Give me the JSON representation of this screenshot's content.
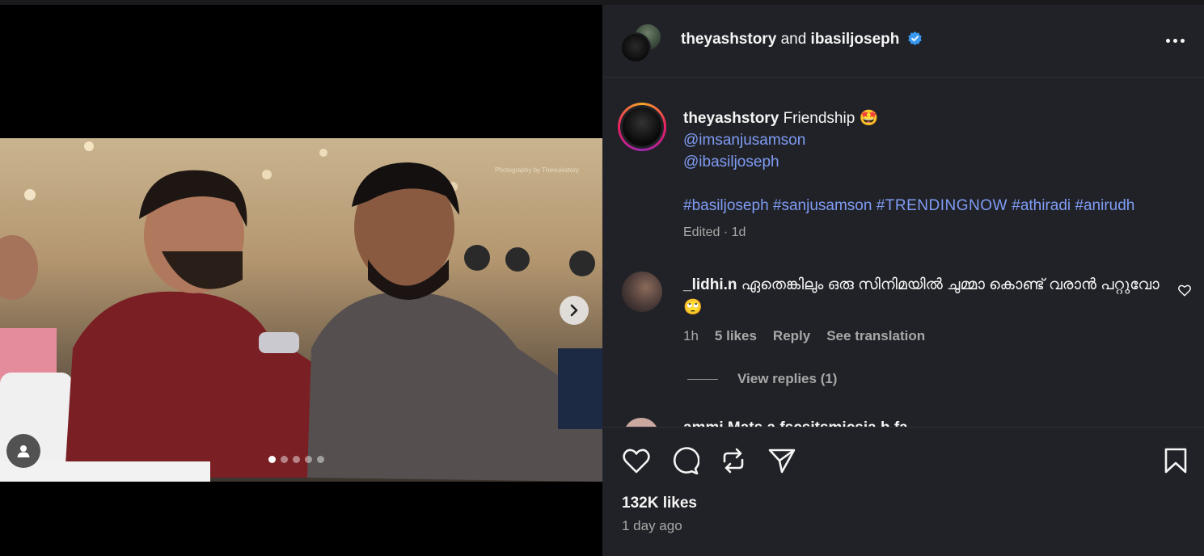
{
  "post": {
    "carousel": {
      "total": 5,
      "active_index": 0
    },
    "watermark": "Photography by Thevuiestory"
  },
  "header": {
    "user1": "theyashstory",
    "joiner": "and",
    "user2": "ibasiljoseph"
  },
  "caption": {
    "username": "theyashstory",
    "text": "Friendship",
    "emoji": "🤩",
    "mention1": "@imsanjusamson",
    "mention2": "@ibasiljoseph",
    "hashtags": {
      "h1": "#basiljoseph",
      "h2": "#sanjusamson",
      "h3": "#TRENDINGNOW",
      "h4": "#athiradi",
      "h5": "#anirudh"
    },
    "meta": "Edited · 1d"
  },
  "comment": {
    "username": "_lidhi.n",
    "text": "ഏതെങ്കിലും ഒരു സിനിമയിൽ ചുമ്മാ കൊണ്ട് വരാൻ പറ്റുവോ",
    "emoji": "🙄",
    "time": "1h",
    "likes": "5 likes",
    "reply": "Reply",
    "translate": "See translation",
    "view_replies": "View replies (1)"
  },
  "next_comment_peek": "ammi.Mats a fscsitsmicsia.b.fa",
  "footer": {
    "likes": "132K likes",
    "time": "1 day ago"
  },
  "colors": {
    "panel_bg": "#212227",
    "link": "#7f9cf5",
    "verified": "#3897f0"
  },
  "icons": {
    "like": "heart-icon",
    "comment": "comment-icon",
    "repost": "repost-icon",
    "share": "send-icon",
    "save": "bookmark-icon"
  }
}
